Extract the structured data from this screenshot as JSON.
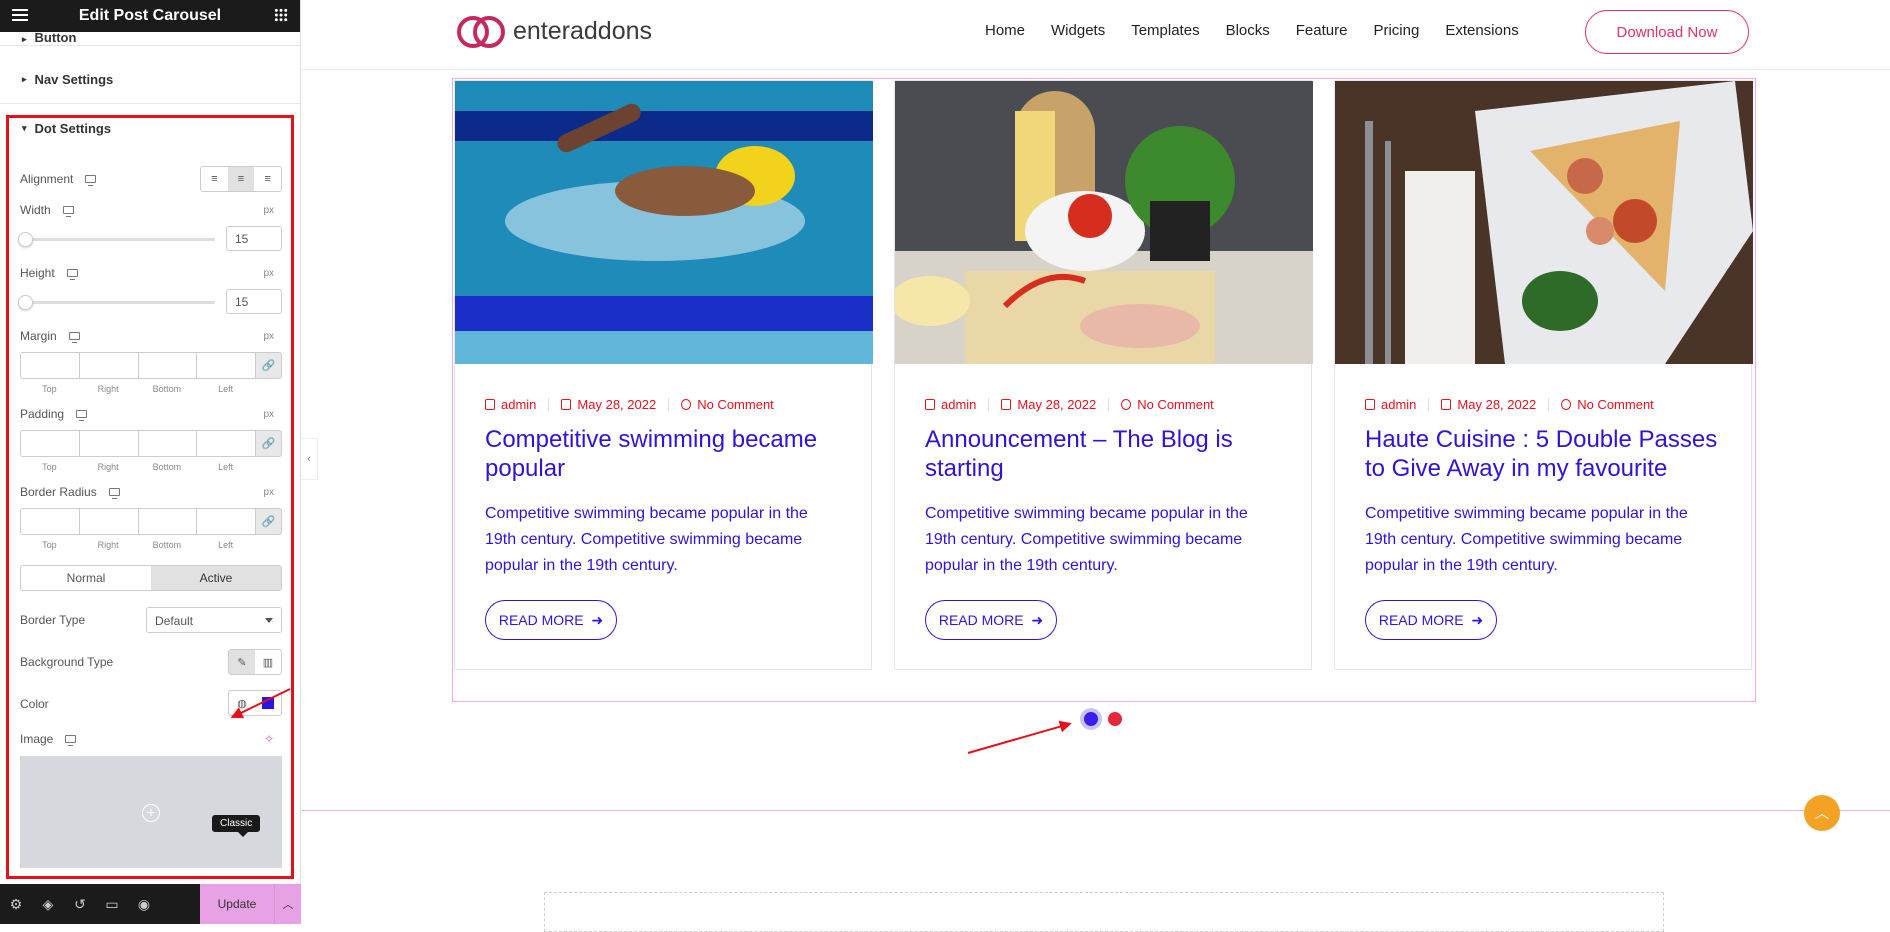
{
  "panel": {
    "title": "Edit Post Carousel",
    "sections": {
      "button": "Button",
      "nav": "Nav Settings",
      "dot": "Dot Settings"
    },
    "alignment_label": "Alignment",
    "width_label": "Width",
    "width_unit": "px",
    "width_value": "15",
    "height_label": "Height",
    "height_unit": "px",
    "height_value": "15",
    "margin_label": "Margin",
    "padding_label": "Padding",
    "radius_label": "Border Radius",
    "unit": "px",
    "dims": [
      "Top",
      "Right",
      "Bottom",
      "Left"
    ],
    "tab_normal": "Normal",
    "tab_active": "Active",
    "border_type_label": "Border Type",
    "border_type_value": "Default",
    "bg_type_label": "Background Type",
    "color_label": "Color",
    "color_value": "#2515e6",
    "image_label": "Image",
    "tooltip": "Classic",
    "update": "Update"
  },
  "site": {
    "brand": "enteraddons",
    "nav": [
      "Home",
      "Widgets",
      "Templates",
      "Blocks",
      "Feature",
      "Pricing",
      "Extensions"
    ],
    "cta": "Download Now",
    "cards": [
      {
        "author": "admin",
        "date": "May 28, 2022",
        "comments": "No Comment",
        "title": "Competitive swimming became popular",
        "excerpt": "Competitive swimming became popular in the 19th century. Competitive swimming became popular in the 19th century.",
        "button": "READ MORE",
        "image": "swimmer-photo"
      },
      {
        "author": "admin",
        "date": "May 28, 2022",
        "comments": "No Comment",
        "title": "Announcement – The Blog is starting",
        "excerpt": "Competitive swimming became popular in the 19th century. Competitive swimming became popular in the 19th century.",
        "button": "READ MORE",
        "image": "kitchen-ingredients-photo"
      },
      {
        "author": "admin",
        "date": "May 28, 2022",
        "comments": "No Comment",
        "title": "Haute Cuisine : 5 Double Passes to Give Away in my favourite",
        "excerpt": "Competitive swimming became popular in the 19th century. Competitive swimming became popular in the 19th century.",
        "button": "READ MORE",
        "image": "pizza-plate-photo"
      }
    ],
    "dot_colors": {
      "active": "#3a1ef0",
      "normal": "#e3283c"
    },
    "accent": "#3013d9"
  }
}
